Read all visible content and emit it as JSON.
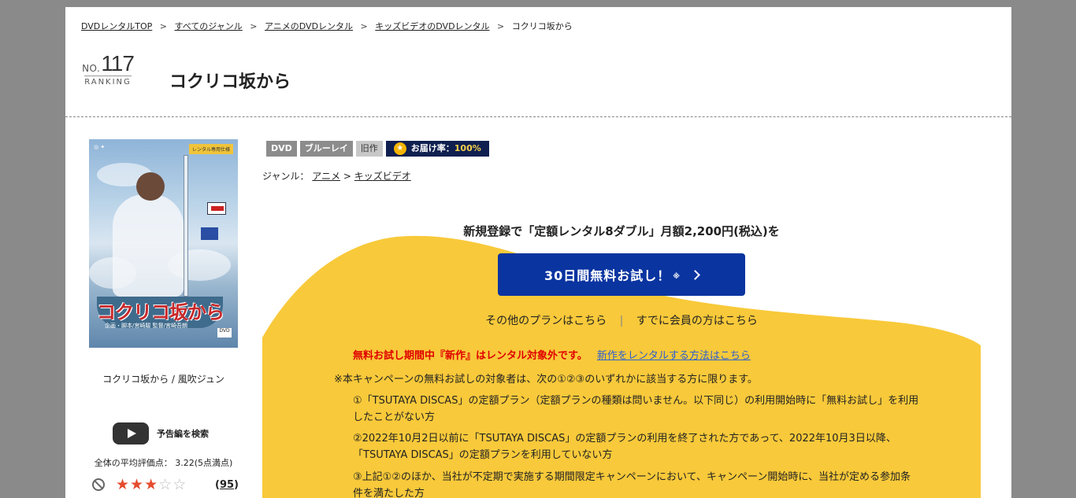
{
  "breadcrumb": {
    "items": [
      "DVDレンタルTOP",
      "すべてのジャンル",
      "アニメのDVDレンタル",
      "キッズビデオのDVDレンタル"
    ],
    "current": "コクリコ坂から",
    "separator": ">"
  },
  "ranking": {
    "prefix": "NO.",
    "number": "117",
    "label": "RANKING"
  },
  "title": "コクリコ坂から",
  "cover": {
    "badge": "レンタル専用仕様",
    "jp_title": "コクリコ坂から",
    "subtitle": "企画・脚本/宮崎駿 監督/宮崎吾朗",
    "dvd_mark": "DVD"
  },
  "caption": "コクリコ坂から / 風吹ジュン",
  "trailer": {
    "label": "予告編を検索"
  },
  "rating": {
    "avg_text": "全体の平均評価点： 3.22(5点満点)",
    "value": 3.22,
    "max": 5,
    "reviews": "95"
  },
  "tags": {
    "dvd": "DVD",
    "bluray": "ブルーレイ",
    "old": "旧作",
    "delivery_label": "お届け率：",
    "delivery_rate": "100%"
  },
  "genre": {
    "label": "ジャンル：",
    "items": [
      "アニメ",
      "キッズビデオ"
    ],
    "sep": ">"
  },
  "promo": {
    "headline": "新規登録で「定額レンタル8ダブル」月額2,200円(税込)を",
    "cta": "30日間無料お試し！",
    "cta_mark": "※",
    "other_plans": "その他のプランはこちら",
    "divider": "|",
    "member": "すでに会員の方はこちら",
    "warning": "無料お試し期間中『新作』はレンタル対象外です。",
    "warning_link": "新作をレンタルする方法はこちら",
    "note": "※本キャンペーンの無料お試しの対象者は、次の①②③のいずれかに該当する方に限ります。",
    "conditions": [
      "①「TSUTAYA DISCAS」の定額プラン（定額プランの種類は問いません。以下同じ）の利用開始時に「無料お試し」を利用したことがない方",
      "②2022年10月2日以前に「TSUTAYA DISCAS」の定額プランの利用を終了された方であって、2022年10月3日以降、「TSUTAYA DISCAS」の定額プランを利用していない方",
      "③上記①②のほか、当社が不定期で実施する期間限定キャンペーンにおいて、キャンペーン開始時に、当社が定める参加条件を満たした方"
    ]
  },
  "colors": {
    "accent_blue": "#0a34a0",
    "promo_yellow": "#f8c93a",
    "warning_red": "#e00000",
    "link_blue": "#2d5fd0",
    "star": "#e54b2d"
  }
}
